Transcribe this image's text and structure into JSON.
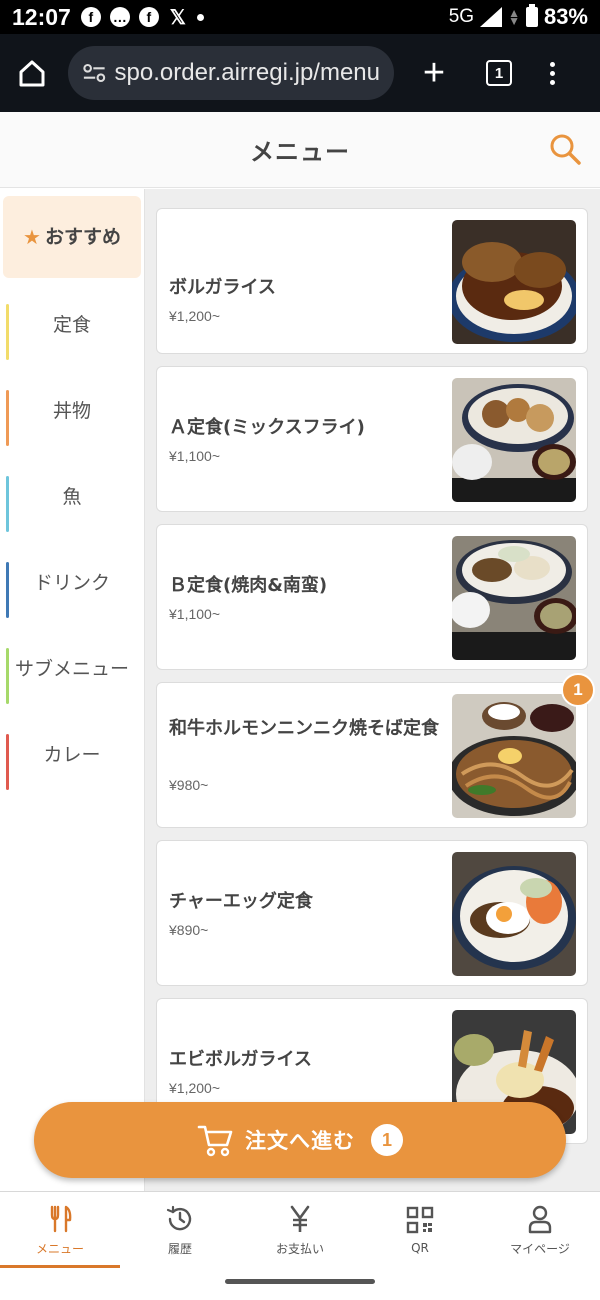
{
  "status_bar": {
    "time": "12:07",
    "network": "5G",
    "battery": "83%",
    "notif_icons": [
      "facebook-icon",
      "chat-icon",
      "facebook-icon",
      "x-icon",
      "dot-icon"
    ]
  },
  "browser": {
    "url": "spo.order.airregi.jp/menu",
    "tab_count": "1"
  },
  "header": {
    "title": "メニュー"
  },
  "sidebar": {
    "items": [
      {
        "label": "おすすめ",
        "color": "#e9943e"
      },
      {
        "label": "定食",
        "color": "#f2dc6a"
      },
      {
        "label": "丼物",
        "color": "#ef9a56"
      },
      {
        "label": "魚",
        "color": "#6ec5dc"
      },
      {
        "label": "ドリンク",
        "color": "#3f79b5"
      },
      {
        "label": "サブメニュー",
        "color": "#a6d96a"
      },
      {
        "label": "カレー",
        "color": "#e05a4f"
      }
    ]
  },
  "menu": {
    "items": [
      {
        "name": "ボルガライス",
        "price": "¥1,200~",
        "image": "omelet-rice-cutlet-photo"
      },
      {
        "name": "Ａ定食(ミックスフライ)",
        "price": "¥1,100~",
        "image": "mixed-fry-set-photo"
      },
      {
        "name": "Ｂ定食(焼肉&南蛮)",
        "price": "¥1,100~",
        "image": "yakiniku-nanban-set-photo"
      },
      {
        "name": "和牛ホルモンニンニク焼そば定食",
        "price": "¥980~",
        "image": "yakisoba-set-photo",
        "badge": "1"
      },
      {
        "name": "チャーエッグ定食",
        "price": "¥890~",
        "image": "chashu-egg-set-photo"
      },
      {
        "name": "エビボルガライス",
        "price": "¥1,200~",
        "image": "shrimp-omelet-rice-photo"
      }
    ]
  },
  "order_button": {
    "label": "注文へ進む",
    "count": "1"
  },
  "bottom_nav": {
    "items": [
      {
        "label": "メニュー",
        "icon": "fork-knife-icon"
      },
      {
        "label": "履歴",
        "icon": "history-icon"
      },
      {
        "label": "お支払い",
        "icon": "yen-icon"
      },
      {
        "label": "QR",
        "icon": "qr-code-icon"
      },
      {
        "label": "マイページ",
        "icon": "person-icon"
      }
    ]
  },
  "colors": {
    "accent": "#e9943e",
    "accent_light": "#fdeede"
  }
}
